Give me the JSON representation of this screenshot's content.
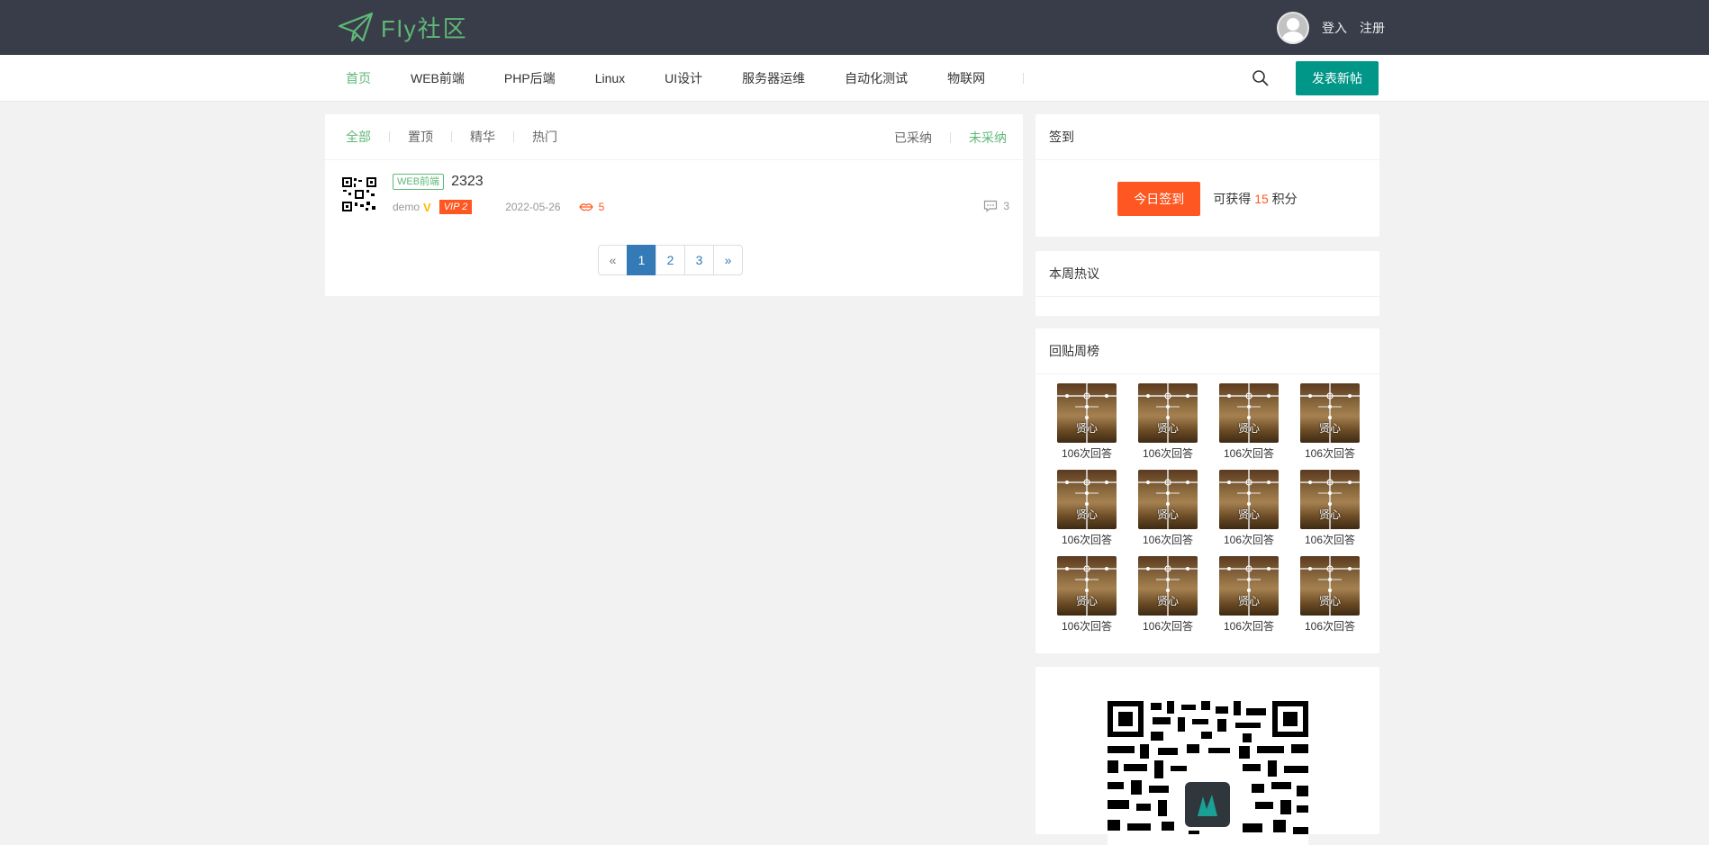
{
  "header": {
    "logo_text": "Fly社区",
    "login_label": "登入",
    "register_label": "注册"
  },
  "nav": {
    "items": [
      {
        "label": "首页",
        "active": true
      },
      {
        "label": "WEB前端"
      },
      {
        "label": "PHP后端"
      },
      {
        "label": "Linux"
      },
      {
        "label": "UI设计"
      },
      {
        "label": "服务器运维"
      },
      {
        "label": "自动化测试"
      },
      {
        "label": "物联网"
      }
    ],
    "post_button": "发表新帖"
  },
  "filters": {
    "left": [
      "全部",
      "置顶",
      "精华",
      "热门"
    ],
    "right": [
      "已采纳",
      "未采纳"
    ]
  },
  "post": {
    "tag": "WEB前端",
    "title": "2323",
    "author": "demo",
    "vip": "VIP 2",
    "date": "2022-05-26",
    "kiss": "5",
    "replies": "3"
  },
  "pager": {
    "prev": "«",
    "pages": [
      "1",
      "2",
      "3"
    ],
    "next": "»",
    "current": "1"
  },
  "sidebar": {
    "sign": {
      "title": "签到",
      "button": "今日签到",
      "text_prefix": "可获得",
      "points": "15",
      "text_suffix": "积分"
    },
    "hot_title": "本周热议",
    "reply_rank": {
      "title": "回贴周榜",
      "users": [
        {
          "name": "贤心",
          "count": "106次回答"
        },
        {
          "name": "贤心",
          "count": "106次回答"
        },
        {
          "name": "贤心",
          "count": "106次回答"
        },
        {
          "name": "贤心",
          "count": "106次回答"
        },
        {
          "name": "贤心",
          "count": "106次回答"
        },
        {
          "name": "贤心",
          "count": "106次回答"
        },
        {
          "name": "贤心",
          "count": "106次回答"
        },
        {
          "name": "贤心",
          "count": "106次回答"
        },
        {
          "name": "贤心",
          "count": "106次回答"
        },
        {
          "name": "贤心",
          "count": "106次回答"
        },
        {
          "name": "贤心",
          "count": "106次回答"
        },
        {
          "name": "贤心",
          "count": "106次回答"
        }
      ]
    }
  },
  "colors": {
    "header_bg": "#393d49",
    "accent_green": "#5fb878",
    "primary": "#009688",
    "orange": "#ff5722",
    "pager_blue": "#337ab7"
  }
}
